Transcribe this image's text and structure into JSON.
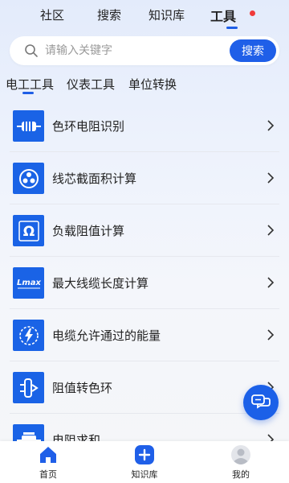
{
  "top_tabs": [
    {
      "label": "社区"
    },
    {
      "label": "搜索"
    },
    {
      "label": "知识库"
    },
    {
      "label": "工具",
      "active": true
    }
  ],
  "search": {
    "placeholder": "请输入关键字",
    "button_label": "搜索"
  },
  "sub_tabs": [
    {
      "label": "电工工具",
      "active": true
    },
    {
      "label": "仪表工具"
    },
    {
      "label": "单位转换"
    }
  ],
  "tools": [
    {
      "label": "色环电阻识别",
      "icon": "resistor-icon"
    },
    {
      "label": "线芯截面积计算",
      "icon": "cable-core-icon"
    },
    {
      "label": "负载阻值计算",
      "icon": "ohm-icon"
    },
    {
      "label": "最大线缆长度计算",
      "icon": "lmax-icon",
      "icon_text": "Lmax"
    },
    {
      "label": "电缆允许通过的能量",
      "icon": "energy-icon"
    },
    {
      "label": "阻值转色环",
      "icon": "convert-icon"
    },
    {
      "label": "电阻求和",
      "icon": "resistor-sum-icon"
    }
  ],
  "bottom_nav": [
    {
      "label": "首页",
      "icon": "home-icon"
    },
    {
      "label": "知识库",
      "icon": "plus-icon"
    },
    {
      "label": "我的",
      "icon": "profile-icon"
    }
  ],
  "colors": {
    "accent": "#1f5fe8",
    "notification": "#f03a3a"
  }
}
